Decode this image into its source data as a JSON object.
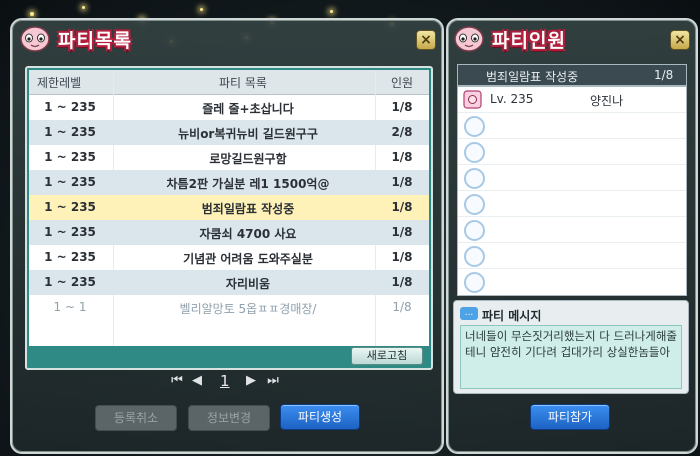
{
  "party_list_window": {
    "title": "파티목록",
    "close_label": "×",
    "columns": {
      "level": "제한레벨",
      "title": "파티 목록",
      "count": "인원"
    },
    "rows": [
      {
        "level": "1 ~ 235",
        "title": "즐레 줄+초삽니다",
        "count": "1/8",
        "style": "white"
      },
      {
        "level": "1 ~ 235",
        "title": "뉴비or복귀뉴비 길드원구구",
        "count": "2/8",
        "style": "alt"
      },
      {
        "level": "1 ~ 235",
        "title": "로망길드원구함",
        "count": "1/8",
        "style": "white"
      },
      {
        "level": "1 ~ 235",
        "title": "차틈2판 가실분 레1 1500억@",
        "count": "1/8",
        "style": "alt"
      },
      {
        "level": "1 ~ 235",
        "title": "범죄일람표 작성중",
        "count": "1/8",
        "style": "selected"
      },
      {
        "level": "1 ~ 235",
        "title": "자쿰쇠 4700 사요",
        "count": "1/8",
        "style": "alt"
      },
      {
        "level": "1 ~ 235",
        "title": "기념관 어려움 도와주실분",
        "count": "1/8",
        "style": "white"
      },
      {
        "level": "1 ~ 235",
        "title": "자리비움",
        "count": "1/8",
        "style": "alt"
      },
      {
        "level": "1 ~ 1",
        "title": "벨리알망토 5옵ㅍㅍ경매장/",
        "count": "1/8",
        "style": "muted"
      }
    ],
    "refresh_label": "새로고침",
    "pagination": {
      "current_page": "1"
    },
    "buttons": {
      "cancel": "등록취소",
      "edit": "정보변경",
      "create": "파티생성"
    }
  },
  "party_member_window": {
    "title": "파티인원",
    "close_label": "×",
    "party_name": "범죄일람표 작성중",
    "member_count": "1/8",
    "members": [
      {
        "level": "Lv. 235",
        "name": "양진나"
      }
    ],
    "message_title": "파티 메시지",
    "message_badge": "...",
    "message_text": "너네들이 무슨짓거리했는지 다 드러나게해줄테니 얌전히 기다려 겁대가리 상실한놈들아",
    "join_button": "파티참가"
  }
}
